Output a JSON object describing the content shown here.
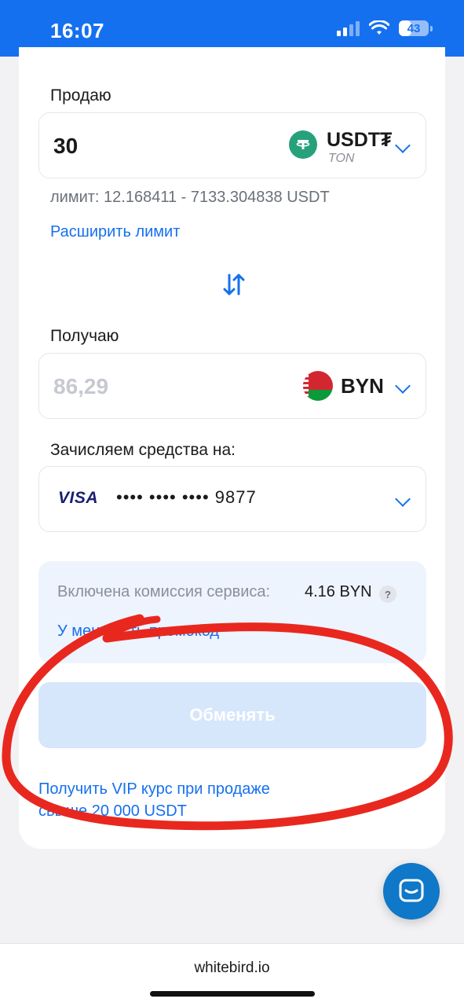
{
  "status_bar": {
    "time": "16:07",
    "battery": "43",
    "battery_level": 0.43
  },
  "sell": {
    "label": "Продаю",
    "amount": "30",
    "coin": "USDT₮",
    "network": "TON",
    "coin_icon": "tether-icon",
    "limit_text": "лимит: 12.168411 - 7133.304838 USDT",
    "expand_limit_link": "Расширить лимит"
  },
  "receive": {
    "label": "Получаю",
    "amount": "86,29",
    "currency": "BYN",
    "currency_icon": "belarus-flag-icon"
  },
  "payout": {
    "label": "Зачисляем средства на:",
    "card_brand": "VISA",
    "card_number": "•••• •••• •••• 9877"
  },
  "fee": {
    "label": "Включена комиссия сервиса:",
    "value": "4.16 BYN",
    "help": "?",
    "promo_link": "У меня есть промокод"
  },
  "exchange_button": "Обменять",
  "vip_link": "Получить VIP курс при продаже свыше 20 000 USDT",
  "footer": {
    "domain": "whitebird.io"
  },
  "colors": {
    "accent": "#1570ef",
    "annotation": "#e8281f",
    "tether": "#26a17b"
  }
}
